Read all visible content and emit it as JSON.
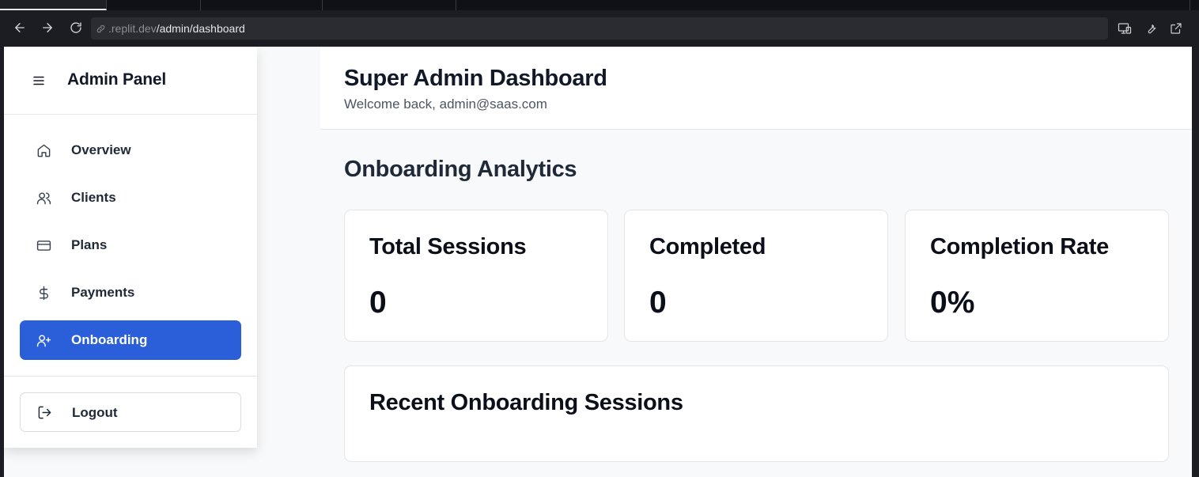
{
  "browser": {
    "url_host": ".replit.dev",
    "url_path": "/admin/dashboard",
    "icons": [
      "back-arrow-icon",
      "forward-arrow-icon",
      "reload-icon",
      "link-icon",
      "devices-icon",
      "wrench-icon",
      "open-external-icon"
    ]
  },
  "sidebar": {
    "title": "Admin Panel",
    "items": [
      {
        "label": "Overview",
        "icon": "home-icon",
        "active": false
      },
      {
        "label": "Clients",
        "icon": "users-icon",
        "active": false
      },
      {
        "label": "Plans",
        "icon": "credit-card-icon",
        "active": false
      },
      {
        "label": "Payments",
        "icon": "dollar-icon",
        "active": false
      },
      {
        "label": "Onboarding",
        "icon": "user-plus-icon",
        "active": true
      }
    ],
    "logout_label": "Logout"
  },
  "header": {
    "title": "Super Admin Dashboard",
    "subtitle": "Welcome back, admin@saas.com"
  },
  "analytics": {
    "section_title": "Onboarding Analytics",
    "cards": [
      {
        "title": "Total Sessions",
        "value": "0"
      },
      {
        "title": "Completed",
        "value": "0"
      },
      {
        "title": "Completion Rate",
        "value": "0%"
      }
    ]
  },
  "recent": {
    "title": "Recent Onboarding Sessions"
  },
  "colors": {
    "accent": "#2b5fd9",
    "page_bg": "#f8f9fb",
    "chrome_bg": "#1c1d22"
  }
}
